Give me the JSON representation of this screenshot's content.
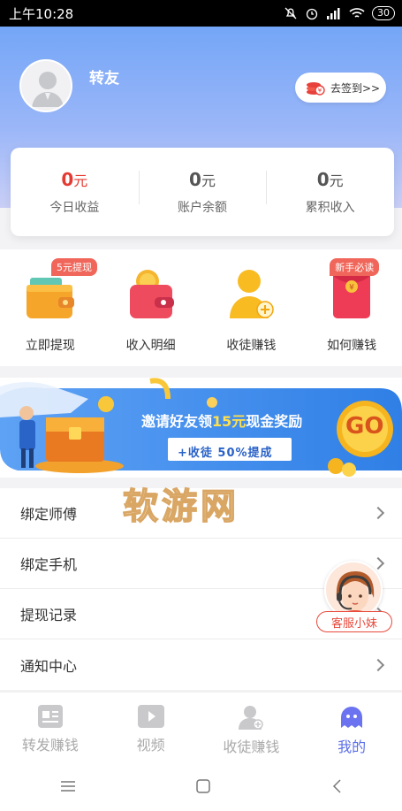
{
  "status_bar": {
    "time": "上午10:28",
    "battery": "30"
  },
  "profile": {
    "name": "转友",
    "signin_label": "去签到>>"
  },
  "stats": [
    {
      "value": "0",
      "unit": "元",
      "label": "今日收益"
    },
    {
      "value": "0",
      "unit": "元",
      "label": "账户余额"
    },
    {
      "value": "0",
      "unit": "元",
      "label": "累积收入"
    }
  ],
  "actions": [
    {
      "label": "立即提现",
      "badge": "5元提现"
    },
    {
      "label": "收入明细"
    },
    {
      "label": "收徒赚钱"
    },
    {
      "label": "如何赚钱",
      "badge": "新手必读"
    }
  ],
  "banner": {
    "title_prefix": "邀请好友领",
    "title_amount": "15元",
    "title_suffix": "现金奖励",
    "subtitle": "+收徒 50%提成",
    "go": "GO"
  },
  "watermark": "软游网",
  "menu": [
    {
      "label": "绑定师傅"
    },
    {
      "label": "绑定手机"
    },
    {
      "label": "提现记录"
    },
    {
      "label": "通知中心"
    }
  ],
  "customer_service": {
    "label": "客服小妹"
  },
  "tabs": [
    {
      "label": "转发赚钱"
    },
    {
      "label": "视频"
    },
    {
      "label": "收徒赚钱"
    },
    {
      "label": "我的"
    }
  ],
  "colors": {
    "accent": "#5b6ee8",
    "red": "#e43a32",
    "hero_top": "#74a6f7"
  }
}
